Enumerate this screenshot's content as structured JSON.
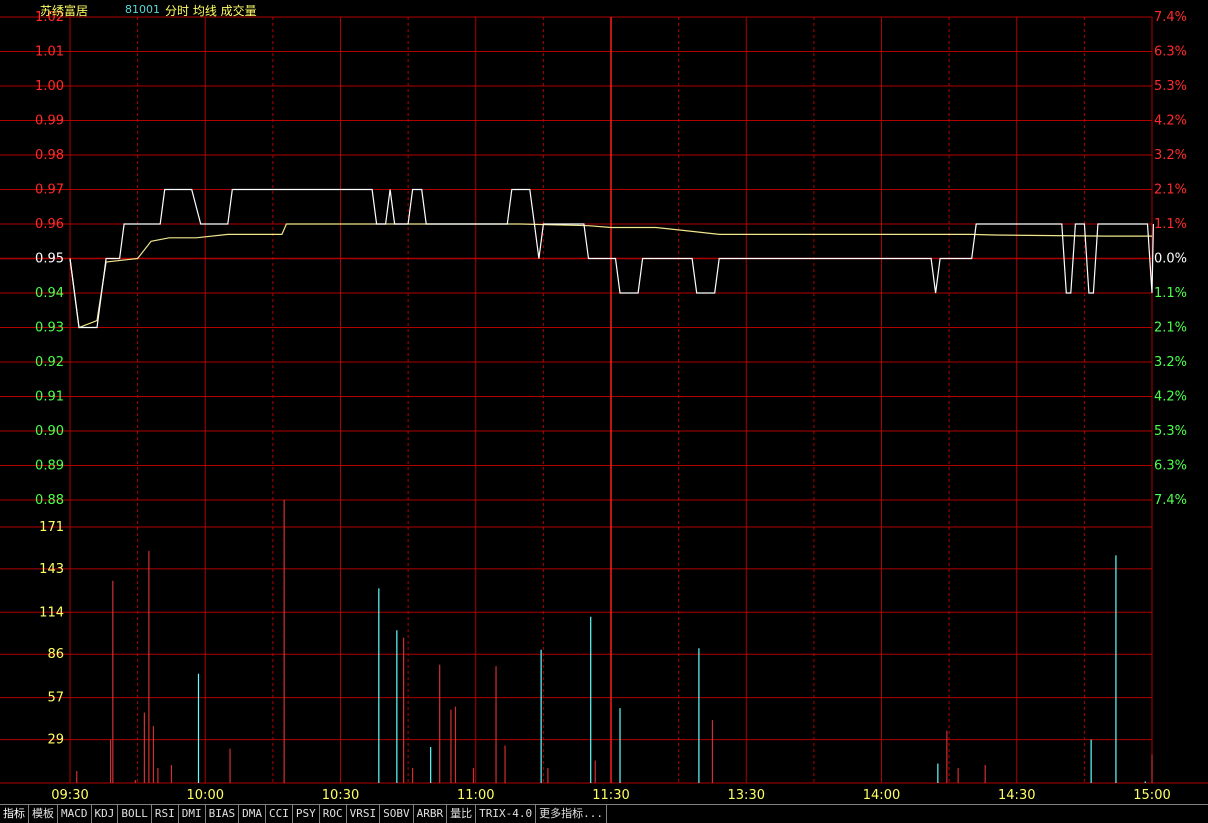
{
  "header": {
    "stock_name": "苏绣富居",
    "stock_code": "81001",
    "legend": "分时 均线 成交量"
  },
  "colors": {
    "background": "#000000",
    "grid": "#b00000",
    "grid_major": "#c80000",
    "price_line": "#ffffff",
    "avg_line": "#f0e68c",
    "up": "#ff2a2a",
    "down": "#4dff4d",
    "flat": "#ffffff",
    "volume_up": "#d03030",
    "volume_down": "#60ffff",
    "volume_axis": "#ffff66",
    "time_axis": "#ffff66"
  },
  "chart_data": {
    "type": "line",
    "prev_close": 0.95,
    "price_axis": {
      "ticks": [
        "1.02",
        "1.01",
        "1.00",
        "0.99",
        "0.98",
        "0.97",
        "0.96",
        "0.95",
        "0.94",
        "0.93",
        "0.92",
        "0.91",
        "0.90",
        "0.89",
        "0.88"
      ],
      "ylim": [
        0.88,
        1.02
      ]
    },
    "pct_axis": {
      "ticks": [
        "7.4%",
        "6.3%",
        "5.3%",
        "4.2%",
        "3.2%",
        "2.1%",
        "1.1%",
        "0.0%",
        "1.1%",
        "2.1%",
        "3.2%",
        "4.2%",
        "5.3%",
        "6.3%",
        "7.4%"
      ]
    },
    "volume_axis": {
      "ticks": [
        "171",
        "143",
        "114",
        "86",
        "57",
        "29"
      ],
      "ylim": [
        0,
        171
      ]
    },
    "time_axis": {
      "ticks": [
        "09:30",
        "10:00",
        "10:30",
        "11:00",
        "11:30",
        "13:30",
        "14:00",
        "14:30",
        "15:00"
      ],
      "total_minutes": 240
    },
    "price_series": [
      [
        0,
        0.95
      ],
      [
        2,
        0.93
      ],
      [
        6,
        0.93
      ],
      [
        8,
        0.95
      ],
      [
        11,
        0.95
      ],
      [
        12,
        0.96
      ],
      [
        20,
        0.96
      ],
      [
        21,
        0.97
      ],
      [
        27,
        0.97
      ],
      [
        29,
        0.96
      ],
      [
        35,
        0.96
      ],
      [
        36,
        0.97
      ],
      [
        67,
        0.97
      ],
      [
        68,
        0.96
      ],
      [
        70,
        0.96
      ],
      [
        71,
        0.97
      ],
      [
        72,
        0.96
      ],
      [
        75,
        0.96
      ],
      [
        76,
        0.97
      ],
      [
        78,
        0.97
      ],
      [
        79,
        0.96
      ],
      [
        97,
        0.96
      ],
      [
        98,
        0.97
      ],
      [
        102,
        0.97
      ],
      [
        103,
        0.96
      ],
      [
        104,
        0.95
      ],
      [
        105,
        0.96
      ],
      [
        114,
        0.96
      ],
      [
        115,
        0.95
      ],
      [
        121,
        0.95
      ],
      [
        122,
        0.94
      ],
      [
        126,
        0.94
      ],
      [
        127,
        0.95
      ],
      [
        138,
        0.95
      ],
      [
        139,
        0.94
      ],
      [
        143,
        0.94
      ],
      [
        144,
        0.95
      ],
      [
        191,
        0.95
      ],
      [
        192,
        0.94
      ],
      [
        193,
        0.95
      ],
      [
        200,
        0.95
      ],
      [
        201,
        0.96
      ],
      [
        220,
        0.96
      ],
      [
        221,
        0.94
      ],
      [
        222,
        0.94
      ],
      [
        223,
        0.96
      ],
      [
        225,
        0.96
      ],
      [
        226,
        0.94
      ],
      [
        227,
        0.94
      ],
      [
        228,
        0.96
      ],
      [
        239,
        0.96
      ],
      [
        240,
        0.94
      ],
      [
        240.3,
        0.96
      ]
    ],
    "avg_series": [
      [
        0,
        0.95
      ],
      [
        2,
        0.93
      ],
      [
        6,
        0.932
      ],
      [
        8,
        0.949
      ],
      [
        15,
        0.95
      ],
      [
        18,
        0.955
      ],
      [
        22,
        0.956
      ],
      [
        28,
        0.956
      ],
      [
        35,
        0.957
      ],
      [
        47,
        0.957
      ],
      [
        48,
        0.96
      ],
      [
        80,
        0.96
      ],
      [
        100,
        0.96
      ],
      [
        115,
        0.9595
      ],
      [
        120,
        0.959
      ],
      [
        130,
        0.959
      ],
      [
        137,
        0.958
      ],
      [
        144,
        0.957
      ],
      [
        180,
        0.957
      ],
      [
        200,
        0.957
      ],
      [
        205,
        0.9568
      ],
      [
        230,
        0.9565
      ],
      [
        240,
        0.9565
      ]
    ],
    "volume_series": [
      [
        1.5,
        8,
        "up"
      ],
      [
        9,
        29,
        "up"
      ],
      [
        9.5,
        135,
        "up"
      ],
      [
        14.5,
        2,
        "up"
      ],
      [
        16.5,
        47,
        "up"
      ],
      [
        17.5,
        155,
        "up"
      ],
      [
        18.5,
        38,
        "up"
      ],
      [
        19.5,
        10,
        "up"
      ],
      [
        22.5,
        12,
        "up"
      ],
      [
        28.5,
        73,
        "down"
      ],
      [
        35.5,
        23,
        "up"
      ],
      [
        47.5,
        189,
        "up"
      ],
      [
        68.5,
        130,
        "down"
      ],
      [
        72.5,
        102,
        "down"
      ],
      [
        74,
        97,
        "up"
      ],
      [
        76,
        10,
        "up"
      ],
      [
        80,
        24,
        "down"
      ],
      [
        82,
        79,
        "up"
      ],
      [
        84.5,
        49,
        "up"
      ],
      [
        85.5,
        51,
        "up"
      ],
      [
        89.5,
        10,
        "up"
      ],
      [
        94.5,
        78,
        "up"
      ],
      [
        96.5,
        25,
        "up"
      ],
      [
        104.5,
        89,
        "down"
      ],
      [
        106,
        10,
        "up"
      ],
      [
        115.5,
        111,
        "down"
      ],
      [
        116.5,
        15,
        "up"
      ],
      [
        122,
        50,
        "down"
      ],
      [
        139.5,
        90,
        "down"
      ],
      [
        142.5,
        42,
        "up"
      ],
      [
        192.5,
        13,
        "down"
      ],
      [
        194.5,
        35,
        "up"
      ],
      [
        197,
        10,
        "up"
      ],
      [
        203,
        12,
        "up"
      ],
      [
        226.5,
        29,
        "down"
      ],
      [
        232,
        152,
        "down"
      ],
      [
        238.5,
        1,
        "down"
      ],
      [
        240,
        19,
        "up"
      ]
    ]
  },
  "indicator_tabs": [
    "指标",
    "模板",
    "MACD",
    "KDJ",
    "BOLL",
    "RSI",
    "DMI",
    "BIAS",
    "DMA",
    "CCI",
    "PSY",
    "ROC",
    "VRSI",
    "SOBV",
    "ARBR",
    "量比",
    "TRIX-4.0",
    "更多指标..."
  ]
}
